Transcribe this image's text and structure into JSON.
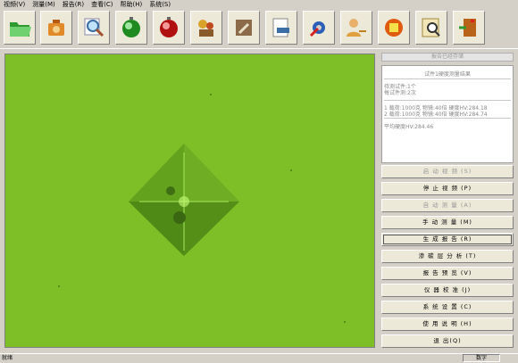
{
  "menu": [
    {
      "label": "视频(V)"
    },
    {
      "label": "测量(M)"
    },
    {
      "label": "报告(R)"
    },
    {
      "label": "查看(C)"
    },
    {
      "label": "帮助(H)"
    },
    {
      "label": "系统(S)"
    }
  ],
  "toolbar": [
    {
      "icon": "folder-open-icon"
    },
    {
      "icon": "camera-bag-icon"
    },
    {
      "icon": "magnifier-icon"
    },
    {
      "icon": "green-record-icon"
    },
    {
      "icon": "red-stop-icon"
    },
    {
      "icon": "gear-figures-icon"
    },
    {
      "icon": "wrench-note-icon"
    },
    {
      "icon": "document-ruler-icon"
    },
    {
      "icon": "tools-gear-icon"
    },
    {
      "icon": "person-key-icon"
    },
    {
      "icon": "warning-sign-icon"
    },
    {
      "icon": "document-magnifier-icon"
    },
    {
      "icon": "exit-door-icon"
    }
  ],
  "panel": {
    "title": "报告已经存储",
    "results_heading": "试件1硬度测量结果",
    "pending": "待测试件:1个",
    "each_test": "每试件测:2次",
    "rows": [
      "1  载荷:1000克 物镜:40倍 硬度HV:284.18",
      "2  载荷:1000克 物镜:40倍 硬度HV:284.74"
    ],
    "average": "平均硬度HV:284.46"
  },
  "buttons": [
    {
      "label": "启 动 视 频 (S)",
      "enabled": false
    },
    {
      "label": "停 止 视 频 (P)",
      "enabled": true
    },
    {
      "label": "自 动 测 量 (A)",
      "enabled": false
    },
    {
      "label": "手 动 测 量 (M)",
      "enabled": true
    },
    {
      "label": "生 成 报 告 (R)",
      "enabled": true
    },
    {
      "label": "渗 碳 层 分 析 (T)",
      "enabled": true
    },
    {
      "label": "报 告 预 览 (V)",
      "enabled": true
    },
    {
      "label": "仪 器 校 准 (J)",
      "enabled": true
    },
    {
      "label": "系 统 设 置 (C)",
      "enabled": true
    },
    {
      "label": "使 用 说 明 (H)",
      "enabled": true
    },
    {
      "label": "退        出(Q)",
      "enabled": true
    }
  ],
  "status": {
    "left": "就绪",
    "right": "数字"
  },
  "colors": {
    "viewport_green": "#7ebf28",
    "window_gray": "#d4d0c8"
  }
}
